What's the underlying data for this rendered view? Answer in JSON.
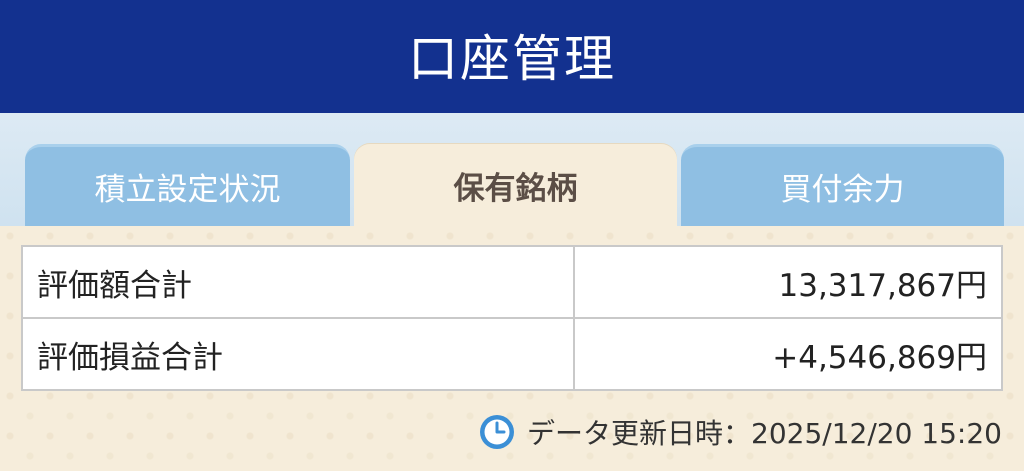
{
  "header": {
    "title": "口座管理"
  },
  "tabs": [
    {
      "label": "積立設定状況",
      "active": false
    },
    {
      "label": "保有銘柄",
      "active": true
    },
    {
      "label": "買付余力",
      "active": false
    }
  ],
  "summary": {
    "rows": [
      {
        "label": "評価額合計",
        "value": "13,317,867円"
      },
      {
        "label": "評価損益合計",
        "value": "+4,546,869円"
      }
    ]
  },
  "updated": {
    "icon": "clock-icon",
    "text": "データ更新日時：2025/12/20 15:20"
  },
  "colors": {
    "header": "#13318f",
    "tab_inactive": "#8fbfe3",
    "tab_active": "#f6eddb",
    "profit": "#c8503b",
    "clock": "#3b8fd6"
  }
}
